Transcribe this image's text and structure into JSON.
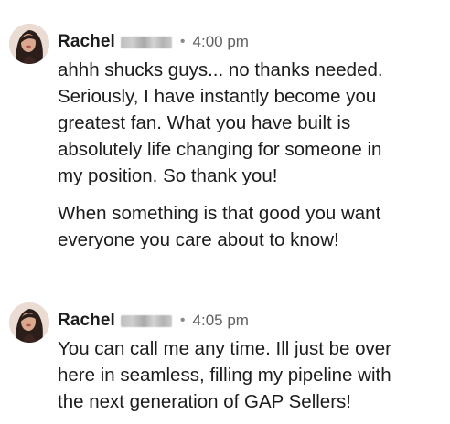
{
  "messages": [
    {
      "author": "Rachel",
      "time": "4:00 pm",
      "separator": "•",
      "paragraphs": [
        [
          "ahhh shucks guys... no thanks needed.",
          "Seriously, I have instantly become you",
          "greatest fan. What you have built is",
          "absolutely life changing for someone in",
          "my position. So thank you!"
        ],
        [
          "When something is that good you want",
          "everyone you care about to know!"
        ]
      ]
    },
    {
      "author": "Rachel",
      "time": "4:05 pm",
      "separator": "•",
      "paragraphs": [
        [
          "You can call me any time. Ill just be over",
          "here in seamless,  filling my pipeline with",
          "the next generation of GAP Sellers!"
        ]
      ]
    }
  ],
  "colors": {
    "text": "#1d1c1d",
    "timestamp": "#616061",
    "background": "#ffffff"
  },
  "icons": {
    "avatar": "user-avatar-photo",
    "name_redaction": "blurred-surname"
  }
}
